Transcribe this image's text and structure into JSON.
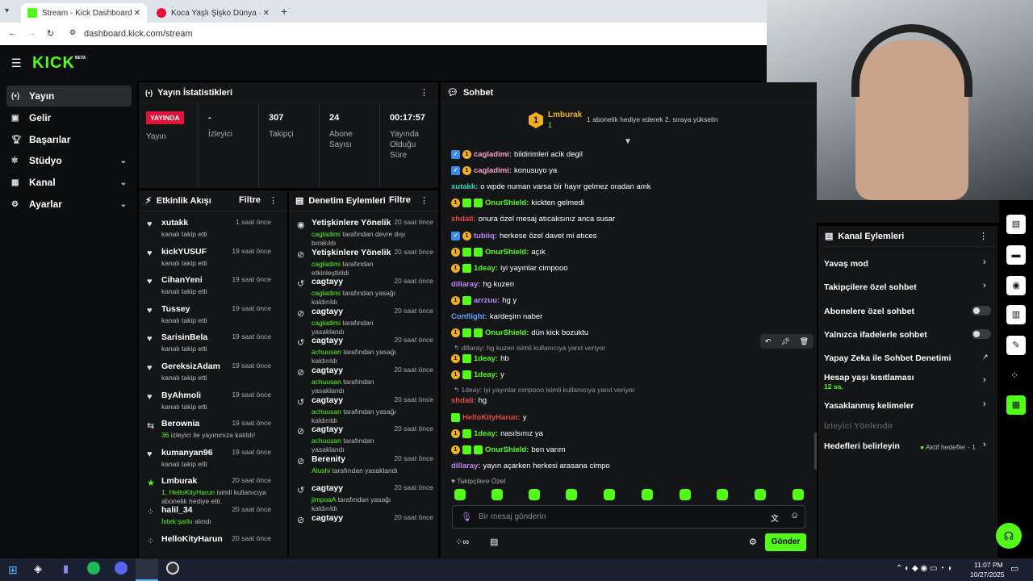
{
  "browser": {
    "tabs": [
      {
        "label": "Stream - Kick Dashboard"
      },
      {
        "label": "Koca Yaşlı Şişko Dünya - Yo"
      }
    ],
    "url": "dashboard.kick.com/stream"
  },
  "logo": "KICK",
  "logo_beta": "BETA",
  "sidebar": [
    {
      "label": "Yayın"
    },
    {
      "label": "Gelir"
    },
    {
      "label": "Başarılar"
    },
    {
      "label": "Stüdyo"
    },
    {
      "label": "Kanal"
    },
    {
      "label": "Ayarlar"
    }
  ],
  "stats": {
    "title": "Yayın İstatistikleri",
    "live": "YAYINDA",
    "live_label": "Yayın",
    "items": [
      {
        "value": "-",
        "label": "İzleyici"
      },
      {
        "value": "307",
        "label": "Takipçi"
      },
      {
        "value": "24",
        "label": "Abone Sayısı"
      },
      {
        "value": "00:17:57",
        "label": "Yayında Olduğu Süre"
      }
    ]
  },
  "activity": {
    "title": "Etkinlik Akışı",
    "filter": "Filtre",
    "items": [
      {
        "name": "xutakk",
        "sub": "kanalı takip etti",
        "time": "1 saat önce"
      },
      {
        "name": "kickYUSUF",
        "sub": "kanalı takip etti",
        "time": "19 saat önce"
      },
      {
        "name": "CihanYeni",
        "sub": "kanalı takip etti",
        "time": "19 saat önce"
      },
      {
        "name": "Tussey",
        "sub": "kanalı takip etti",
        "time": "19 saat önce"
      },
      {
        "name": "SarisinBela",
        "sub": "kanalı takip etti",
        "time": "19 saat önce"
      },
      {
        "name": "GereksizAdam",
        "sub": "kanalı takip etti",
        "time": "19 saat önce"
      },
      {
        "name": "ByAhmoli",
        "sub": "kanalı takip etti",
        "time": "19 saat önce"
      },
      {
        "name": "Berownia",
        "hl": "36",
        "sub": " izleyici ile yayınınıza katıldı!",
        "time": "19 saat önce"
      },
      {
        "name": "kumanyan96",
        "sub": "kanalı takip etti",
        "time": "19 saat önce"
      },
      {
        "name": "Lmburak",
        "hl": "1, HelloKityHarun",
        "sub": " isimli kullanıcıya abonelik hediye etti.",
        "time": "20 saat önce"
      },
      {
        "name": "halil_34",
        "hl": "İstek şarkı",
        "sub": " alındı",
        "time": "20 saat önce"
      },
      {
        "name": "HelloKityHarun",
        "sub": "",
        "time": "20 saat önce"
      }
    ]
  },
  "moderation": {
    "title": "Denetim Eylemleri",
    "filter": "Filtre",
    "items": [
      {
        "name": "Yetişkinlere Yönelik",
        "hl": "cagladimi",
        "sub": " tarafından devre dışı bırakıldı",
        "time": "20 saat önce"
      },
      {
        "name": "Yetişkinlere Yönelik",
        "hl": "cagladimi",
        "sub": " tarafından etkinleştirildi",
        "time": "20 saat önce"
      },
      {
        "name": "cagtayy",
        "hl": "cagladimi",
        "sub": " tarafından yasağı kaldırıldı",
        "time": "20 saat önce"
      },
      {
        "name": "cagtayy",
        "hl": "cagladimi",
        "sub": " tarafından yasaklandı",
        "time": "20 saat önce"
      },
      {
        "name": "cagtayy",
        "hl": "achuusan",
        "sub": " tarafından yasağı kaldırıldı",
        "time": "20 saat önce"
      },
      {
        "name": "cagtayy",
        "hl": "achuusan",
        "sub": " tarafından yasaklandı",
        "time": "20 saat önce"
      },
      {
        "name": "cagtayy",
        "hl": "achuusan",
        "sub": " tarafından yasağı kaldırıldı",
        "time": "20 saat önce"
      },
      {
        "name": "cagtayy",
        "hl": "achuusan",
        "sub": " tarafından yasaklandı",
        "time": "20 saat önce"
      },
      {
        "name": "Berenity",
        "hl": "Alushi",
        "sub": " tarafından yasaklandı",
        "time": "20 saat önce"
      },
      {
        "name": "cagtayy",
        "hl": "jimpoaA",
        "sub": " tarafından yasağı kaldırıldı",
        "time": "20 saat önce"
      },
      {
        "name": "cagtayy",
        "hl": "",
        "sub": "",
        "time": "20 saat önce"
      }
    ]
  },
  "chat": {
    "title": "Sohbet",
    "pinned_user": "Lmburak",
    "pinned_count": "1",
    "pinned_msg": "1 abonelik hediye ederek 2. sıraya yükselin",
    "messages": [
      {
        "user": "cagladimi",
        "color": "#f4a0c8",
        "text": "bildirimleri acik degil",
        "badges": [
          "sq",
          "c"
        ]
      },
      {
        "user": "cagladimi",
        "color": "#f4a0c8",
        "text": "konusuyo ya",
        "badges": [
          "sq",
          "c"
        ]
      },
      {
        "user": "xutakk",
        "color": "#2dd4bf",
        "text": "o wpde numan varsa bir hayır gelmez oradan amk",
        "badges": []
      },
      {
        "user": "OnurShield",
        "color": "#53fc18",
        "text": "kickten gelmedi",
        "badges": [
          "c",
          "g",
          "g"
        ]
      },
      {
        "user": "shdali",
        "color": "#e84a4a",
        "text": "onura özel mesaj atıcaksınız anca susar",
        "badges": []
      },
      {
        "user": "tubiiq",
        "color": "#c084fc",
        "text": "herkese özel davet mi atıces",
        "badges": [
          "sq",
          "c"
        ]
      },
      {
        "user": "OnurShield",
        "color": "#53fc18",
        "text": "açık",
        "badges": [
          "c",
          "g",
          "g"
        ]
      },
      {
        "user": "1deay",
        "color": "#53fc18",
        "text": "iyi yayınlar cimpooo",
        "badges": [
          "c",
          "g"
        ]
      },
      {
        "user": "dillaray",
        "color": "#c084fc",
        "text": "hg kuzen",
        "badges": []
      },
      {
        "user": "arrzuu",
        "color": "#c084fc",
        "text": "hg y",
        "badges": [
          "c",
          "g"
        ]
      },
      {
        "user": "Conflight",
        "color": "#60a5fa",
        "text": "kardeşim naber",
        "badges": []
      },
      {
        "user": "OnurShield",
        "color": "#53fc18",
        "text": "dün kick bozuktu",
        "badges": [
          "c",
          "g",
          "g"
        ]
      },
      {
        "reply": "dillaray: hg kuzen isimli kullanıcıya yanıt veriyor",
        "user": "1deay",
        "color": "#53fc18",
        "text": "hb",
        "badges": [
          "c",
          "g"
        ]
      },
      {
        "user": "1deay",
        "color": "#53fc18",
        "text": "y",
        "badges": [
          "c",
          "g"
        ]
      },
      {
        "reply": "1deay: iyi yayınlar cimpooo isimli kullanıcıya yanıt veriyor",
        "user": "shdali",
        "color": "#e84a4a",
        "text": "hg",
        "badges": []
      },
      {
        "user": "HelloKityHarun",
        "color": "#e84a4a",
        "text": "y",
        "badges": [
          "g"
        ]
      },
      {
        "user": "1deay",
        "color": "#53fc18",
        "text": "nasılsınız ya",
        "badges": [
          "c",
          "g"
        ]
      },
      {
        "user": "OnurShield",
        "color": "#53fc18",
        "text": "ben varım",
        "badges": [
          "c",
          "g",
          "g"
        ]
      },
      {
        "user": "dillaray",
        "color": "#c084fc",
        "text": "yayın açarken herkesi arasana cimpo",
        "badges": []
      }
    ],
    "followers_only": "Takipçilere Özel",
    "input_placeholder": "Bir mesaj gönderin",
    "send": "Gönder"
  },
  "channel_actions": {
    "title": "Kanal Eylemleri",
    "items": [
      {
        "label": "Yavaş mod"
      },
      {
        "label": "Takipçilere özel sohbet"
      },
      {
        "label": "Abonelere özel sohbet"
      },
      {
        "label": "Yalnızca ifadelerle sohbet"
      },
      {
        "label": "Yapay Zeka ile Sohbet Denetimi"
      },
      {
        "label": "Hesap yaşı kısıtlaması",
        "sub": "12 sa."
      },
      {
        "label": "Yasaklanmış kelimeler"
      },
      {
        "label": "İzleyici Yönlendir"
      },
      {
        "label": "Hedefleri belirleyin",
        "extra": "Aktif hedefler - 1"
      }
    ]
  },
  "taskbar": {
    "time": "11:07 PM",
    "date": "10/27/2025"
  },
  "colors": {
    "accent": "#53fc18",
    "live": "#e0133a",
    "panel": "#131517"
  }
}
